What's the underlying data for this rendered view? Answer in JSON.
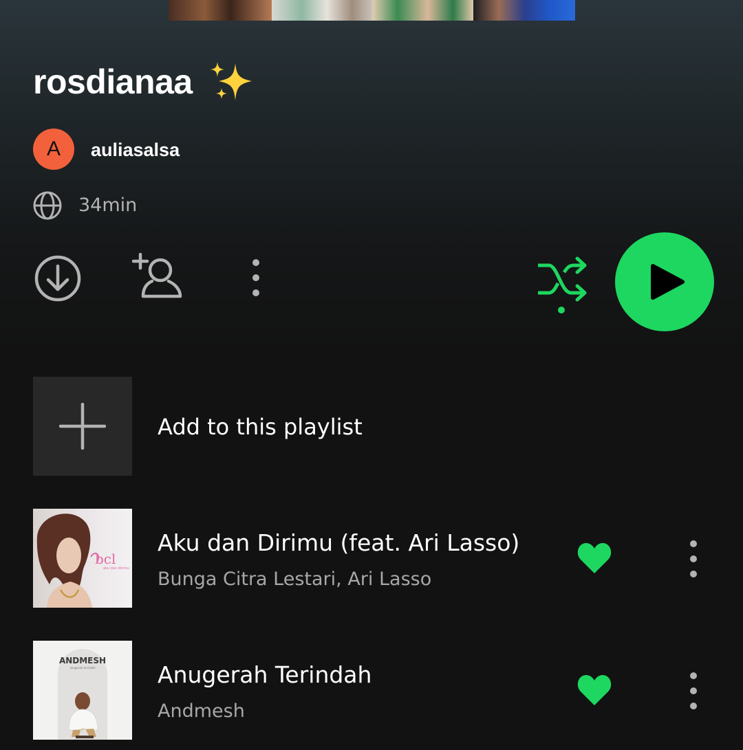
{
  "header": {
    "cover_collage": "playlist cover collage (top cropped)"
  },
  "playlist": {
    "title": "rosdianaa",
    "title_emoji": "sparkles-icon",
    "owner": {
      "avatar_letter": "A",
      "avatar_color": "#f2613b",
      "name": "auliasalsa"
    },
    "visibility_icon": "globe-icon",
    "duration": "34min"
  },
  "actions": {
    "download_icon": "download-icon",
    "add_collaborator_icon": "add-user-icon",
    "more_icon": "more-vertical-icon",
    "shuffle_icon": "shuffle-icon",
    "shuffle_enabled": true,
    "play_icon": "play-icon"
  },
  "add_to_playlist": {
    "icon": "plus-icon",
    "label": "Add to this playlist"
  },
  "tracks": [
    {
      "title": "Aku dan Dirimu (feat. Ari Lasso)",
      "artist": "Bunga Citra Lestari, Ari Lasso",
      "liked": true,
      "art_text": "bcl"
    },
    {
      "title": "Anugerah Terindah",
      "artist": "Andmesh",
      "liked": true,
      "art_text": "ANDMESH"
    }
  ],
  "colors": {
    "accent": "#1ed760",
    "background": "#121212",
    "secondary_text": "#a7a7a7",
    "icon_grey": "#b3b3b3"
  }
}
